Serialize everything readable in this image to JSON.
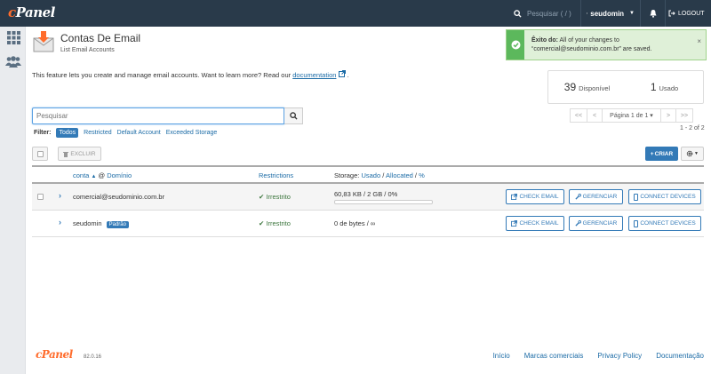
{
  "topbar": {
    "logo": "cPanel",
    "search_placeholder": "Pesquisar ( / )",
    "username": "seudomin",
    "logout_label": "LOGOUT"
  },
  "page": {
    "title": "Contas De Email",
    "subtitle": "List Email Accounts"
  },
  "alert": {
    "title": "Êxito do:",
    "message": "All of your changes to “comercial@seudominio.com.br” are saved.",
    "close": "×"
  },
  "intro": {
    "text": "This feature lets you create and manage email accounts. Want to learn more? Read our",
    "link": "documentation",
    "end": "."
  },
  "stats": {
    "available_count": "39",
    "available_label": "Disponível",
    "used_count": "1",
    "used_label": "Usado"
  },
  "search": {
    "placeholder": "Pesquisar"
  },
  "pager": {
    "first": "<<",
    "prev": "<",
    "page_label": "Página 1 de 1 ▾",
    "next": ">",
    "last": ">>",
    "count": "1 - 2 of 2"
  },
  "filter": {
    "label": "Filter:",
    "options": [
      "Todos",
      "Restricted",
      "Default Account",
      "Exceeded Storage"
    ]
  },
  "toolbar": {
    "delete_label": "EXCLUIR",
    "create_label": "CRIAR"
  },
  "table": {
    "headers": {
      "account": "conta",
      "at": "@",
      "domain": "Domínio",
      "restrictions": "Restrictions",
      "storage_prefix": "Storage:",
      "used": "Usado",
      "allocated": "Allocated",
      "percent": "%"
    },
    "rows": [
      {
        "account": "comercial@seudominio.com.br",
        "badge": "",
        "restriction": "Irrestrito",
        "storage": "60,83 KB / 2 GB / 0%",
        "usage_fraction": 0.0,
        "check_email": "CHECK EMAIL",
        "manage": "GERENCIAR",
        "connect": "CONNECT DEVICES"
      },
      {
        "account": "seudomin",
        "badge": "Padrão",
        "restriction": "Irrestrito",
        "storage": "0 de bytes / ∞",
        "check_email": "CHECK EMAIL",
        "manage": "GERENCIAR",
        "connect": "CONNECT DEVICES"
      }
    ]
  },
  "footer": {
    "logo": "cPanel",
    "version": "82.0.16",
    "links": [
      "Início",
      "Marcas comerciais",
      "Privacy Policy",
      "Documentação"
    ]
  },
  "colors": {
    "topbar": "#293a4a",
    "brand_orange": "#ff6c2c",
    "primary": "#337ab7",
    "success": "#5cb85c"
  }
}
